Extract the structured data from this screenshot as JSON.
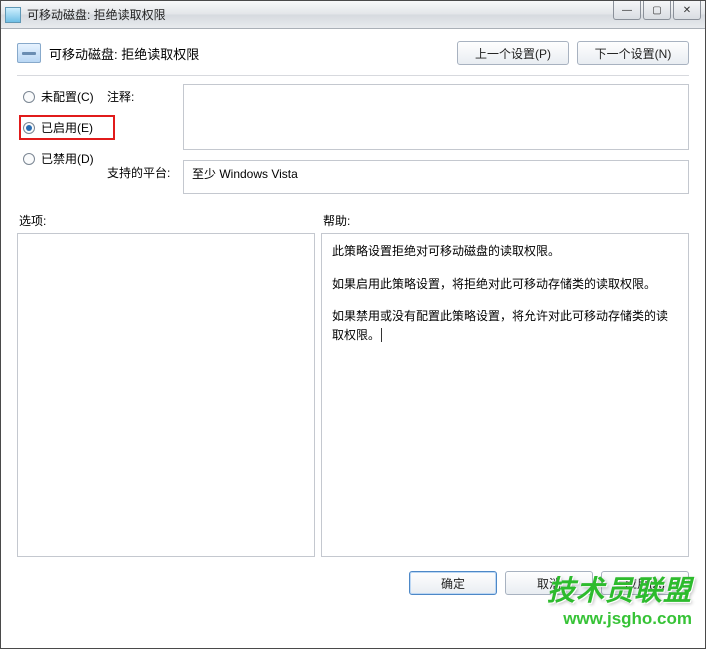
{
  "window": {
    "title": "可移动磁盘: 拒绝读取权限",
    "min": "—",
    "max": "▢",
    "close": "✕"
  },
  "header": {
    "title": "可移动磁盘: 拒绝读取权限",
    "prev": "上一个设置(P)",
    "next": "下一个设置(N)"
  },
  "radios": {
    "unconfigured": "未配置(C)",
    "enabled": "已启用(E)",
    "disabled": "已禁用(D)"
  },
  "labels": {
    "comment": "注释:",
    "platform": "支持的平台:",
    "options": "选项:",
    "help": "帮助:"
  },
  "values": {
    "comment": "",
    "platform": "至少 Windows Vista"
  },
  "help": {
    "p1": "此策略设置拒绝对可移动磁盘的读取权限。",
    "p2": "如果启用此策略设置，将拒绝对此可移动存储类的读取权限。",
    "p3": "如果禁用或没有配置此策略设置，将允许对此可移动存储类的读取权限。"
  },
  "footer": {
    "ok": "确定",
    "cancel": "取消",
    "apply": "应用(A)"
  },
  "watermark": {
    "line1": "技术员联盟",
    "line2": "www.jsgho.com"
  }
}
